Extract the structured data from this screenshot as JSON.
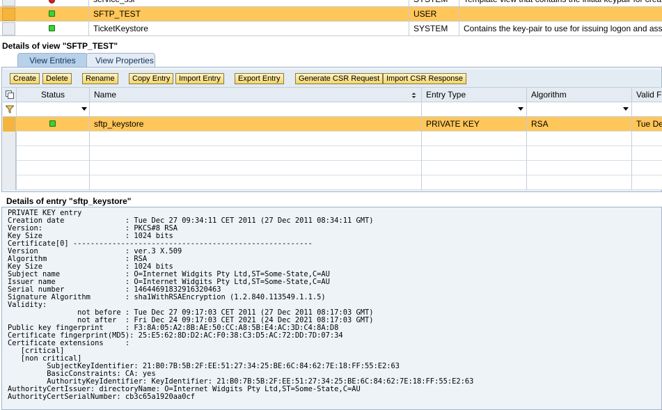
{
  "top_table": {
    "rows": [
      {
        "name": "service_ssl",
        "type": "SYSTEM",
        "description": "Template view that contains the initial keypair for creating",
        "status": "red"
      },
      {
        "name": "SFTP_TEST",
        "type": "USER",
        "description": "",
        "status": "green"
      },
      {
        "name": "TicketKeystore",
        "type": "SYSTEM",
        "description": "Contains the key-pair to use for issuing logon and assertion",
        "status": "green"
      }
    ]
  },
  "view_details": {
    "title": "Details of view \"SFTP_TEST\"",
    "tabs": [
      "View Entries",
      "View Properties"
    ]
  },
  "toolbar": {
    "buttons": [
      "Create",
      "Delete",
      "Rename",
      "Copy Entry",
      "Import Entry",
      "Export Entry",
      "Generate CSR Request",
      "Import CSR Response"
    ]
  },
  "entries_table": {
    "headers": [
      "Status",
      "Name",
      "Entry Type",
      "Algorithm",
      "Valid Fr"
    ],
    "sort_icon": "sort-updown-icon",
    "rows": [
      {
        "name": "sftp_keystore",
        "entry_type": "PRIVATE KEY",
        "algorithm": "RSA",
        "valid_from": "Tue Dec",
        "status": "green"
      }
    ]
  },
  "entry_details": {
    "title": "Details of entry \"sftp_keystore\"",
    "text": "PRIVATE KEY entry\nCreation date              : Tue Dec 27 09:34:11 CET 2011 (27 Dec 2011 08:34:11 GMT)\nVersion:                   : PKCS#8 RSA\nKey Size                   : 1024 bits\nCertificate[0] -------------------------------------------------------\nVersion                    : ver.3 X.509\nAlgorithm                  : RSA\nKey Size                   : 1024 bits\nSubject name               : O=Internet Widgits Pty Ltd,ST=Some-State,C=AU\nIssuer name                : O=Internet Widgits Pty Ltd,ST=Some-State,C=AU\nSerial number              : 14644691832916320463\nSignature Algorithm        : sha1WithRSAEncryption (1.2.840.113549.1.1.5)\nValidity:\n                not before : Tue Dec 27 09:17:03 CET 2011 (27 Dec 2011 08:17:03 GMT)\n                not after  : Fri Dec 24 09:17:03 CET 2021 (24 Dec 2021 08:17:03 GMT)\nPublic key fingerprint     : F3:8A:05:A2:8B:AE:50:CC:A8:5B:E4:AC:3D:C4:8A:D8\nCertificate fingerprint(MD5): 25:E5:62:8D:D2:AC:F0:38:C3:D5:AC:72:DD:7D:07:34\nCertificate extensions     :\n   [critical]\n   [non critical]\n         SubjectKeyIdentifier: 21:B0:7B:5B:2F:EE:51:27:34:25:BE:6C:84:62:7E:18:FF:55:E2:63\n         BasicConstraints: CA: yes\n         AuthorityKeyIdentifier: KeyIdentifier: 21:B0:7B:5B:2F:EE:51:27:34:25:BE:6C:84:62:7E:18:FF:55:E2:63\nAuthorityCertIssuer: directoryName: O=Internet Widgits Pty Ltd,ST=Some-State,C=AU\nAuthorityCertSerialNumber: cb3c65a1920aa0cf"
  },
  "colors": {
    "selected_row": "#ffc659",
    "tab_active": "#b7d1ea",
    "button": "#f3d56b",
    "status_green": "#37d337",
    "status_red": "#d02020"
  }
}
